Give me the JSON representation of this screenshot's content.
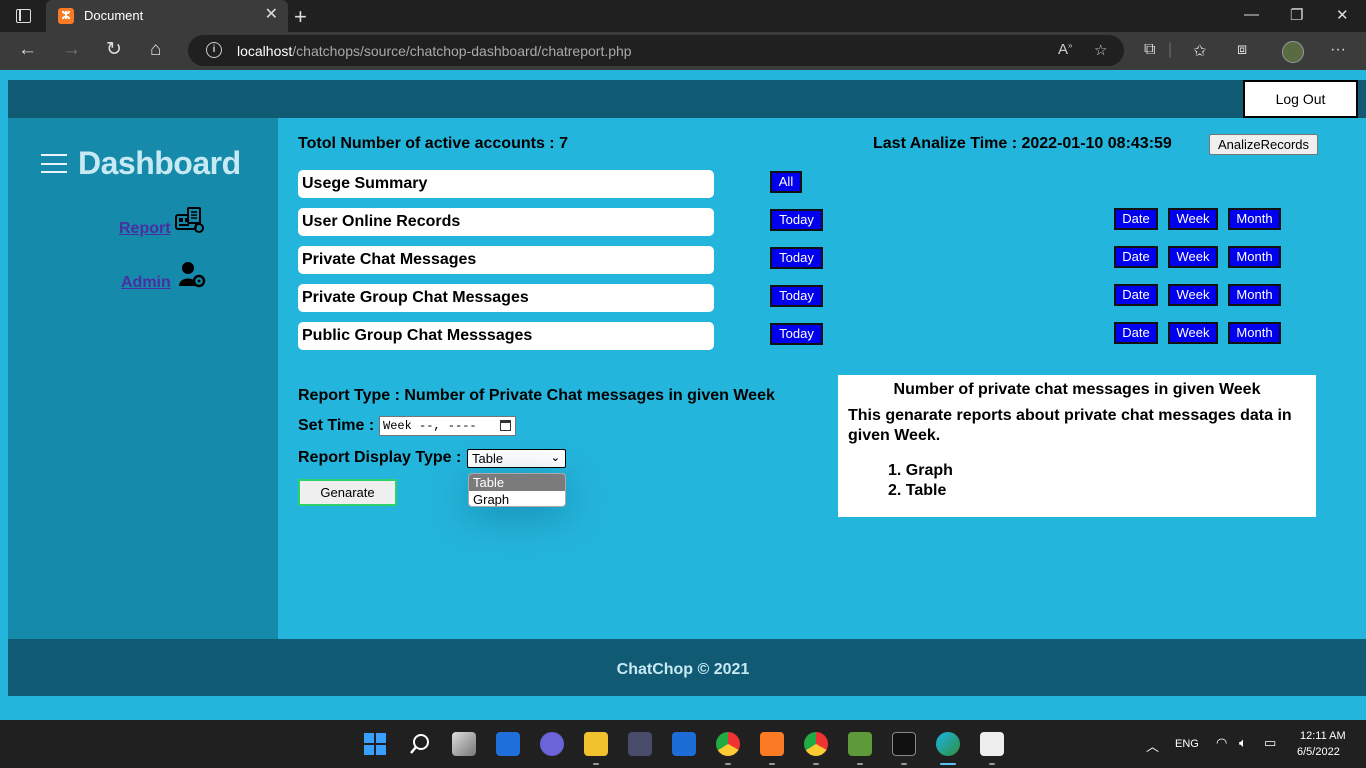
{
  "browser": {
    "tab_title": "Document",
    "url_host": "localhost",
    "url_path": "/chatchops/source/chatchop-dashboard/chatreport.php"
  },
  "header": {
    "logout_label": "Log Out"
  },
  "sidebar": {
    "title": "Dashboard",
    "items": [
      {
        "label": "Report",
        "icon": "report-icon"
      },
      {
        "label": "Admin",
        "icon": "admin-icon"
      }
    ]
  },
  "main": {
    "total_accounts": "Totol Number of active accounts : 7",
    "last_analize": "Last Analize Time : 2022-01-10 08:43:59",
    "analize_button": "AnalizeRecords",
    "reports": [
      {
        "label": "Usege Summary",
        "buttons": [
          "All"
        ]
      },
      {
        "label": "User Online Records",
        "buttons": [
          "Today",
          "Date",
          "Week",
          "Month"
        ]
      },
      {
        "label": "Private Chat Messages",
        "buttons": [
          "Today",
          "Date",
          "Week",
          "Month"
        ]
      },
      {
        "label": "Private Group Chat Messages",
        "buttons": [
          "Today",
          "Date",
          "Week",
          "Month"
        ]
      },
      {
        "label": "Public Group Chat Messsages",
        "buttons": [
          "Today",
          "Date",
          "Week",
          "Month"
        ]
      }
    ],
    "report_type": "Report Type : Number of Private Chat messages in given Week",
    "set_time_label": "Set Time :",
    "week_input_value": "Week --, ----",
    "display_type_label": "Report Display Type :",
    "display_type_selected": "Table",
    "display_type_options": [
      "Table",
      "Graph"
    ],
    "generate_button": "Genarate"
  },
  "info": {
    "title": "Number of private chat messages in given Week",
    "description": "This genarate reports about private chat messages data in given Week.",
    "items": [
      "1. Graph",
      "2. Table"
    ]
  },
  "footer": {
    "text": "ChatChop © 2021"
  },
  "taskbar": {
    "lang": "ENG",
    "time": "12:11 AM",
    "date": "6/5/2022"
  },
  "colors": {
    "page_bg": "#24b5dc",
    "dark_bar": "#115a73",
    "sidebar": "#168aab",
    "button_blue": "#0000ee"
  }
}
